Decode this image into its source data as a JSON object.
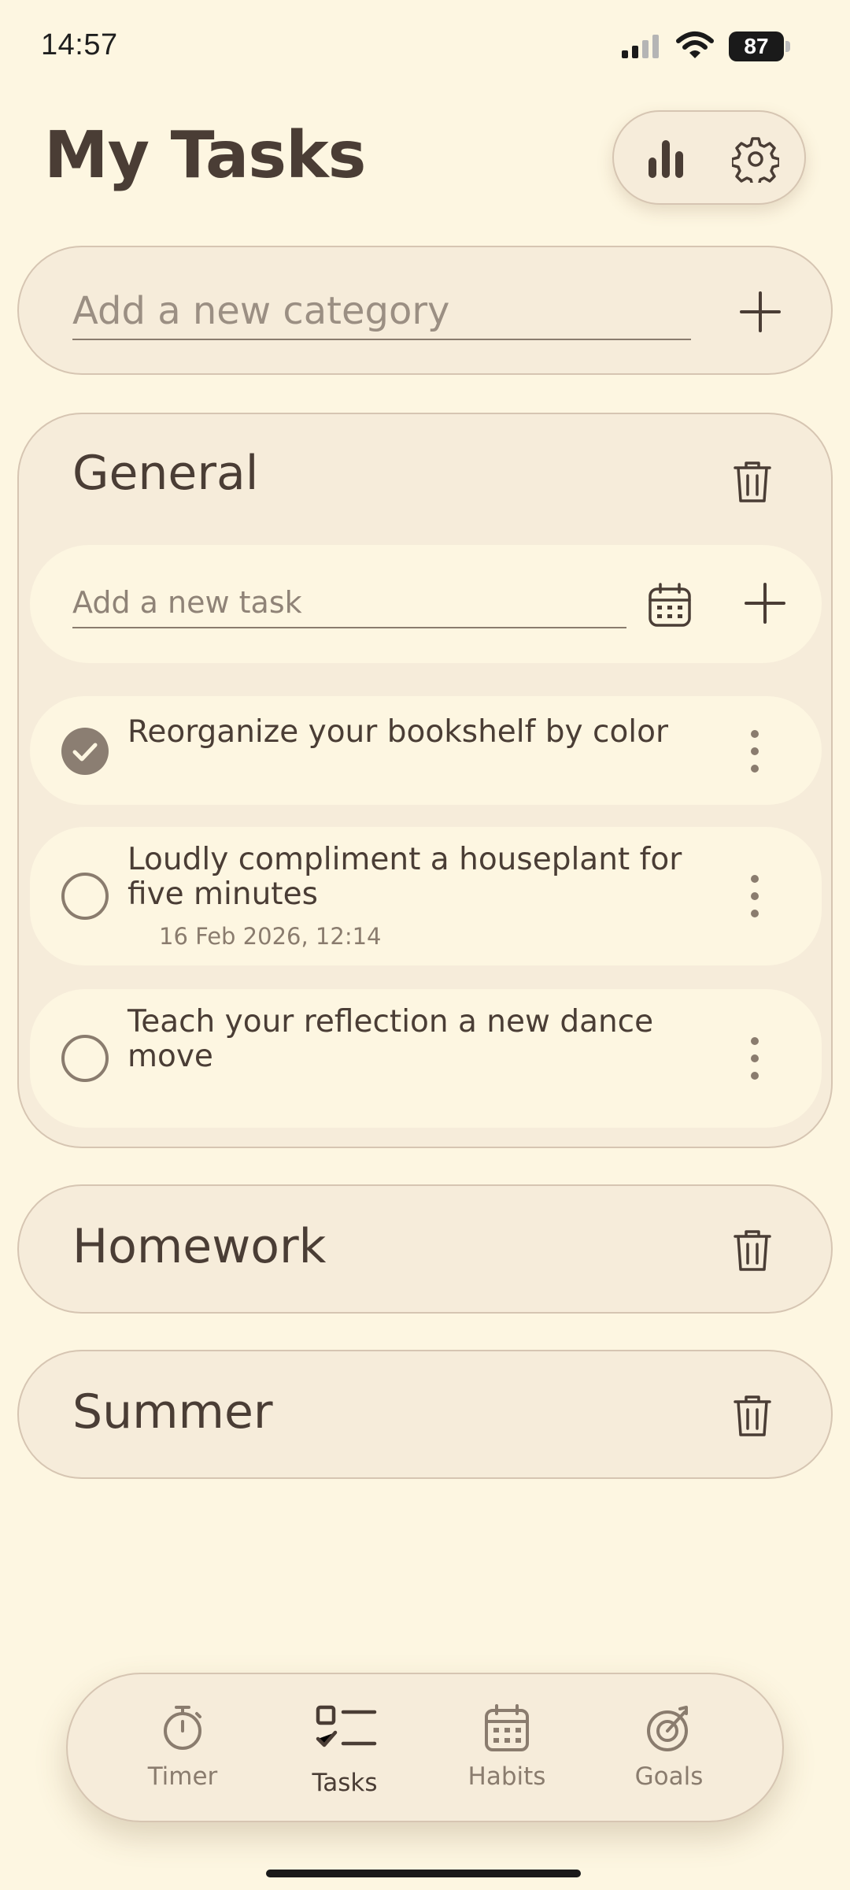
{
  "status_bar": {
    "time": "14:57",
    "battery": "87",
    "icons": [
      "cellular-signal-icon",
      "wifi-icon",
      "battery-icon"
    ]
  },
  "header": {
    "title": "My Tasks",
    "actions": [
      "bar-chart-icon",
      "gear-icon"
    ]
  },
  "add_category": {
    "placeholder": "Add a new category",
    "icon": "plus-icon"
  },
  "categories": [
    {
      "name": "General",
      "expanded": true,
      "task_input": {
        "placeholder": "Add a new task",
        "icons": [
          "calendar-icon",
          "plus-icon"
        ]
      },
      "tasks": [
        {
          "text": "Reorganize your bookshelf by color",
          "done": true,
          "date": ""
        },
        {
          "text": "Loudly compliment a houseplant for five minutes",
          "done": false,
          "date": "16 Feb 2026, 12:14"
        },
        {
          "text": "Teach your reflection a new dance move",
          "done": false,
          "date": ""
        }
      ]
    },
    {
      "name": "Homework",
      "expanded": false
    },
    {
      "name": "Summer",
      "expanded": false
    }
  ],
  "bottom_nav": {
    "items": [
      {
        "label": "Timer",
        "icon": "stopwatch-icon",
        "active": false
      },
      {
        "label": "Tasks",
        "icon": "checklist-icon",
        "active": true
      },
      {
        "label": "Habits",
        "icon": "calendar-icon",
        "active": false
      },
      {
        "label": "Goals",
        "icon": "target-icon",
        "active": false
      }
    ]
  },
  "colors": {
    "background": "#FDF6E1",
    "card": "#F6ECDA",
    "border": "#D6C5B2",
    "text": "#4A3D35",
    "muted": "#8A7C6E",
    "checked": "#8B7E72"
  }
}
